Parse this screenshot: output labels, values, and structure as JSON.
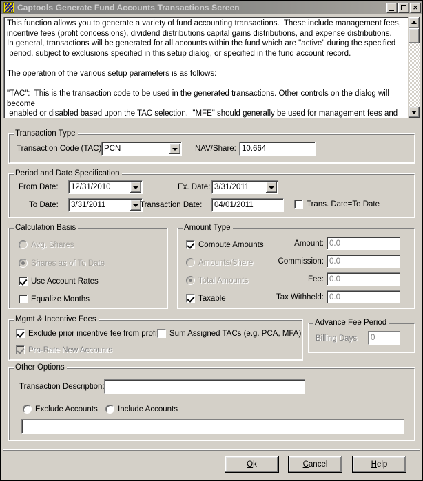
{
  "window": {
    "title": "Captools Generate Fund Accounts Transactions Screen",
    "icon": "captools-app-icon",
    "controls": {
      "minimize": "minimize-button",
      "maximize": "maximize-button",
      "close_label": "✕"
    }
  },
  "description": {
    "text": "This function allows you to generate a variety of fund accounting transactions.  These include management fees,\nincentive fees (profit concessions), dividend distributions capital gains distributions, and expense distributions.\nIn general, transactions will be generated for all accounts within the fund which are \"active\" during the specified\n period, subject to exclusions specified in this setup dialog, or specified in the fund account record.\n\nThe operation of the various setup parameters is as follows:\n\n\"TAC\":  This is the transaction code to be used in the generated transactions. Other controls on the dialog will become\n enabled or disabled based upon the TAC selection.  \"MFE\" should generally be used for management fees and \"PCN\" for\n incentive fees."
  },
  "transaction_type": {
    "legend": "Transaction Type",
    "tac_label": "Transaction Code (TAC)",
    "tac_value": "PCN",
    "nav_label": "NAV/Share:",
    "nav_value": "10.664"
  },
  "period": {
    "legend": "Period and Date Specification",
    "from_label": "From Date:",
    "from_value": "12/31/2010",
    "to_label": "To Date:",
    "to_value": "3/31/2011",
    "ex_label": "Ex. Date:",
    "ex_value": "3/31/2011",
    "trans_label": "Transaction Date:",
    "trans_value": "04/01/2011",
    "trans_eq_to_label": "Trans. Date=To Date",
    "trans_eq_to_checked": false
  },
  "calculation_basis": {
    "legend": "Calculation Basis",
    "avg_shares_label": "Avg. Shares",
    "avg_shares_selected": false,
    "avg_shares_enabled": false,
    "shares_asof_label": "Shares as of To Date",
    "shares_asof_selected": true,
    "shares_asof_enabled": false,
    "use_account_rates_label": "Use Account Rates",
    "use_account_rates_checked": true,
    "equalize_months_label": "Equalize Months",
    "equalize_months_checked": false
  },
  "amount_type": {
    "legend": "Amount Type",
    "compute_label": "Compute Amounts",
    "compute_checked": true,
    "amounts_share_label": "Amounts/Share",
    "amounts_share_selected": false,
    "amounts_share_enabled": false,
    "total_amounts_label": "Total Amounts",
    "total_amounts_selected": true,
    "total_amounts_enabled": false,
    "taxable_label": "Taxable",
    "taxable_checked": true,
    "fields": [
      {
        "label": "Amount:",
        "value": "0.0",
        "enabled": false
      },
      {
        "label": "Commission:",
        "value": "0.0",
        "enabled": false
      },
      {
        "label": "Fee:",
        "value": "0.0",
        "enabled": false
      },
      {
        "label": "Tax Withheld:",
        "value": "0.0",
        "enabled": false
      }
    ]
  },
  "mgmt_fees": {
    "legend": "Mgmt & Incentive Fees",
    "exclude_prior_label": "Exclude prior incentive fee from profit",
    "exclude_prior_checked": true,
    "sum_assigned_label": "Sum Assigned TACs (e.g. PCA, MFA)",
    "sum_assigned_checked": false,
    "pro_rate_label": "Pro-Rate New Accounts",
    "pro_rate_checked": true,
    "pro_rate_enabled": false
  },
  "advance_fee": {
    "legend": "Advance Fee Period",
    "billing_days_label": "Billing Days",
    "billing_days_value": "0",
    "enabled": false
  },
  "other_options": {
    "legend": "Other Options",
    "description_label": "Transaction Description:",
    "description_value": "",
    "exclude_label": "Exclude Accounts",
    "exclude_selected": false,
    "include_label": "Include Accounts",
    "include_selected": false,
    "accounts_value": ""
  },
  "buttons": {
    "ok": {
      "mnemonic": "O",
      "rest": "k"
    },
    "cancel": {
      "mnemonic": "C",
      "rest": "ancel"
    },
    "help": {
      "mnemonic": "H",
      "rest": "elp"
    }
  }
}
